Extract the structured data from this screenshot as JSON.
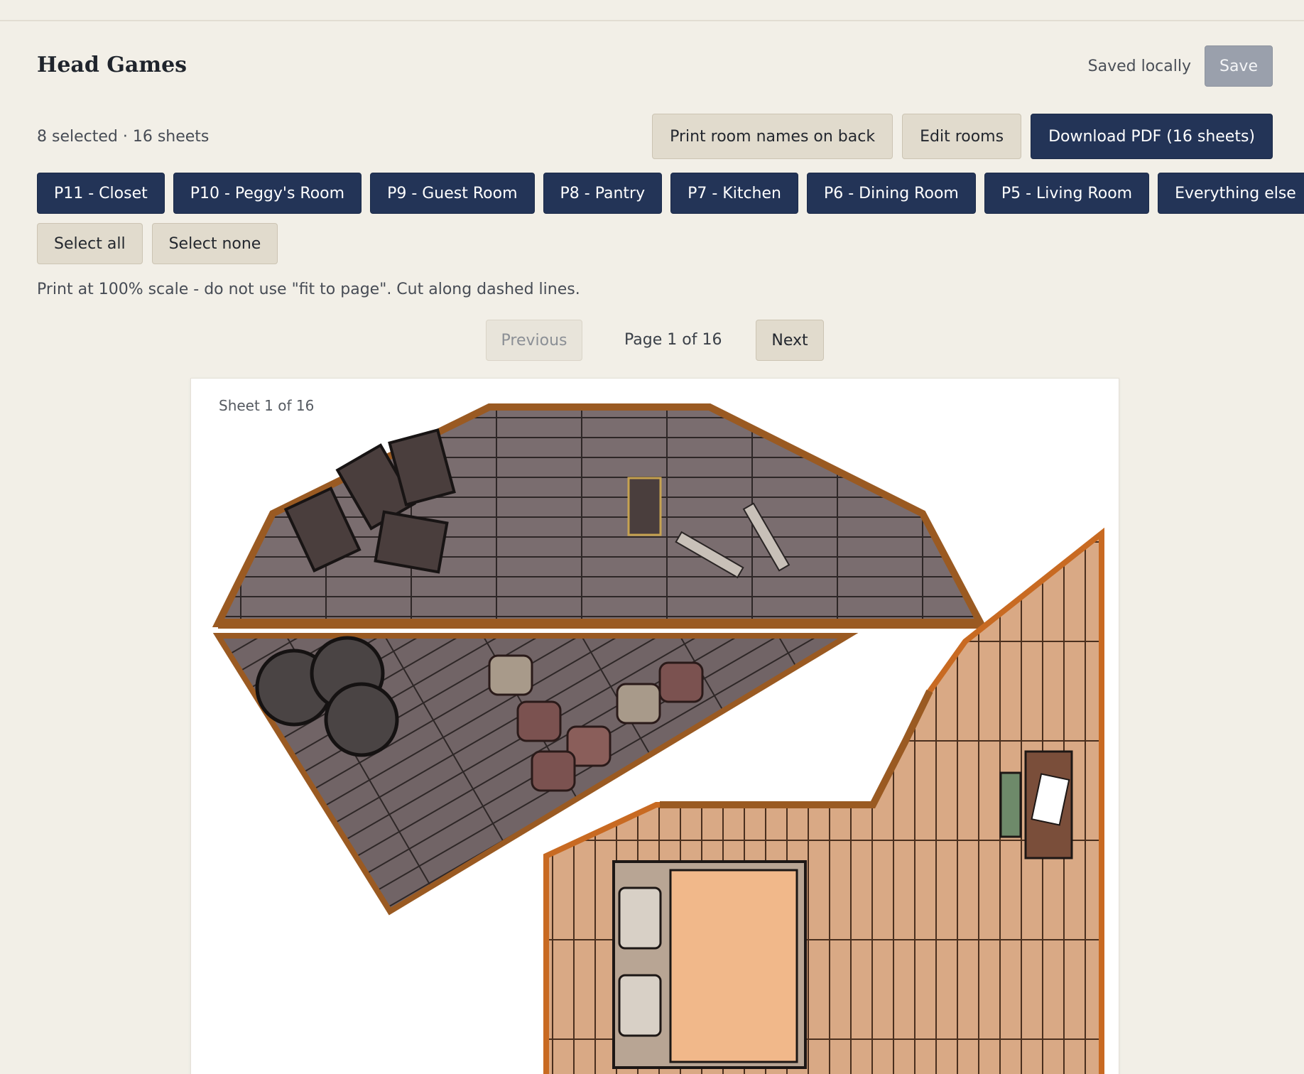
{
  "project": {
    "title": "Head Games",
    "save_status": "Saved locally",
    "save_label": "Save"
  },
  "toolbar": {
    "selection_summary": "8 selected · 16 sheets",
    "print_names_label": "Print room names on back",
    "edit_rooms_label": "Edit rooms",
    "download_label": "Download PDF (16 sheets)"
  },
  "rooms": [
    {
      "label": "P11 - Closet"
    },
    {
      "label": "P10 - Peggy's Room"
    },
    {
      "label": "P9 - Guest Room"
    },
    {
      "label": "P8 - Pantry"
    },
    {
      "label": "P7 - Kitchen"
    },
    {
      "label": "P6 - Dining Room"
    },
    {
      "label": "P5 - Living Room"
    },
    {
      "label": "Everything else"
    }
  ],
  "selection": {
    "select_all_label": "Select all",
    "select_none_label": "Select none"
  },
  "instructions": "Print at 100% scale - do not use \"fit to page\". Cut along dashed lines.",
  "pager": {
    "previous_label": "Previous",
    "page_label": "Page 1 of 16",
    "next_label": "Next"
  },
  "sheet": {
    "label": "Sheet 1 of 16"
  },
  "colors": {
    "background": "#f2efe7",
    "primary": "#233457",
    "secondary": "#e1dbcd",
    "save_disabled": "#9aa0ac",
    "wood_dark_floor": "#7a6d6f",
    "wood_rim": "#9a5a22",
    "wood_warm_floor": "#d7a781"
  }
}
